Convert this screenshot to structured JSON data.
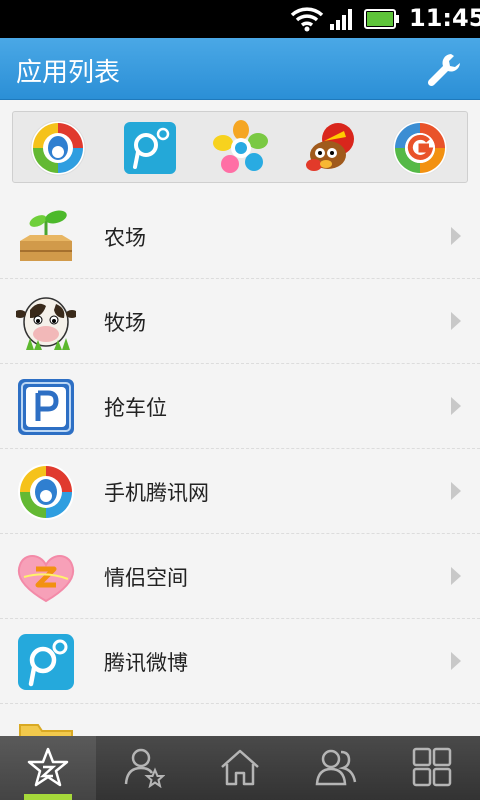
{
  "status_bar": {
    "time": "11:45",
    "icons": [
      "wifi-icon",
      "signal-icon",
      "battery-icon"
    ]
  },
  "header": {
    "title": "应用列表",
    "settings_icon": "wrench-icon"
  },
  "quick_apps": [
    {
      "icon": "qq-browser-icon"
    },
    {
      "icon": "tencent-weibo-icon"
    },
    {
      "icon": "pinwheel-app-icon"
    },
    {
      "icon": "cartoon-game-icon"
    },
    {
      "icon": "g-app-icon"
    }
  ],
  "apps": [
    {
      "label": "农场",
      "icon": "farm-icon"
    },
    {
      "label": "牧场",
      "icon": "ranch-cow-icon"
    },
    {
      "label": "抢车位",
      "icon": "parking-icon"
    },
    {
      "label": "手机腾讯网",
      "icon": "tencent-mobile-web-icon"
    },
    {
      "label": "情侣空间",
      "icon": "couple-space-icon"
    },
    {
      "label": "腾讯微博",
      "icon": "tencent-weibo-icon"
    }
  ],
  "bottom_nav": {
    "items": [
      "favorites-star-icon",
      "contact-star-icon",
      "home-icon",
      "friends-icon",
      "grid-apps-icon"
    ],
    "active_index": 0
  },
  "colors": {
    "header_blue": "#3b9de0",
    "active_indicator": "#a6d93a"
  }
}
